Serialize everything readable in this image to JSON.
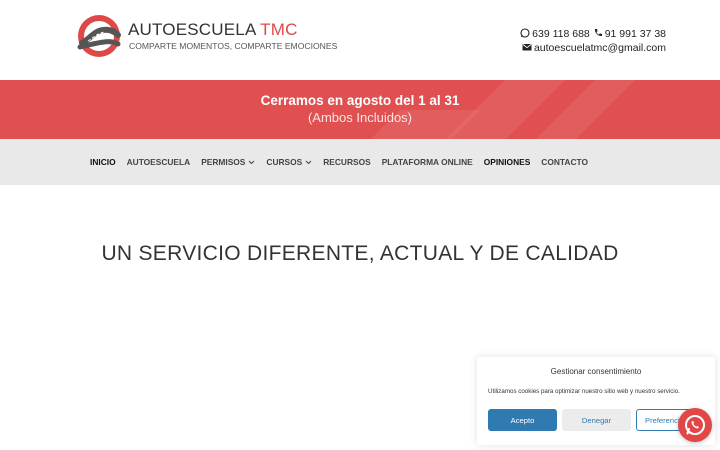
{
  "colors": {
    "brand_red": "#e04848",
    "banner_red": "#e05050",
    "nav_bg": "#e9e9e9",
    "cookie_blue": "#2f7ab0"
  },
  "header": {
    "brand_main": "AUTOESCUELA ",
    "brand_accent": "TMC",
    "tagline": "COMPARTE MOMENTOS, COMPARTE EMOCIONES",
    "phone_mobile": "639 118 688",
    "phone_landline": "91 991 37 38",
    "email": "autoescuelatmc@gmail.com",
    "icons": [
      "whatsapp-icon",
      "phone-icon",
      "envelope-icon"
    ]
  },
  "banner": {
    "title": "Cerramos en agosto del 1 al 31",
    "subtitle": "(Ambos Incluidos)"
  },
  "nav": {
    "items": [
      {
        "label": "INICIO"
      },
      {
        "label": "AUTOESCUELA"
      },
      {
        "label": "PERMISOS"
      },
      {
        "label": "CURSOS"
      },
      {
        "label": "RECURSOS"
      },
      {
        "label": "PLATAFORMA ONLINE"
      },
      {
        "label": "OPINIONES"
      },
      {
        "label": "CONTACTO"
      }
    ]
  },
  "main": {
    "headline": "UN SERVICIO DIFERENTE, ACTUAL Y DE CALIDAD"
  },
  "cookie": {
    "title": "Gestionar consentimiento",
    "text": "Utilizamos cookies para optimizar nuestro sitio web y nuestro servicio.",
    "accept": "Acepto",
    "deny": "Denegar",
    "preferences": "Preferencias"
  }
}
